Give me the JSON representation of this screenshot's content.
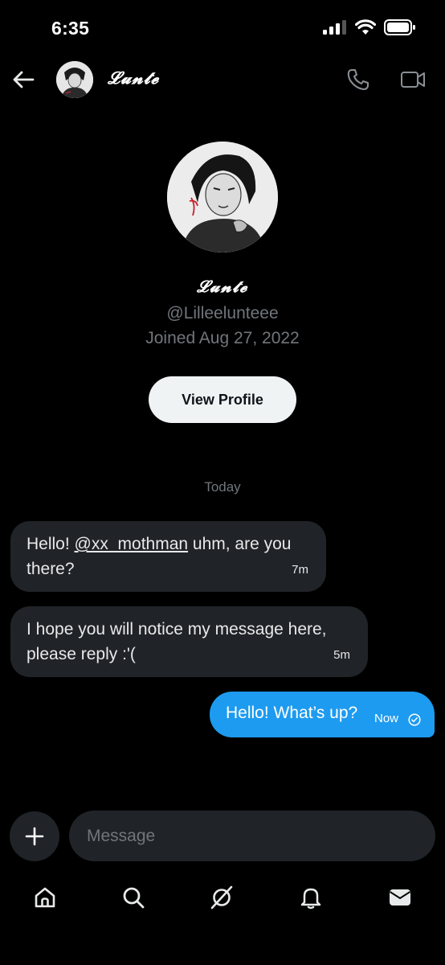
{
  "status_bar": {
    "time": "6:35"
  },
  "header": {
    "name": "𝓛𝓾𝓷𝓽𝓮",
    "back_icon": "arrow-left-icon",
    "call_icon": "phone-icon",
    "video_icon": "video-camera-icon"
  },
  "profile": {
    "display_name": "𝓛𝓾𝓷𝓽𝓮",
    "handle": "@Lilleelunteee",
    "joined": "Joined Aug 27, 2022",
    "view_profile_label": "View Profile"
  },
  "conversation": {
    "date_separator": "Today",
    "messages": [
      {
        "direction": "incoming",
        "text_before": "Hello! ",
        "mention": "@xx_mothman",
        "text_line1_after": " uhm, are you",
        "text_line2": "there?",
        "time": "7m"
      },
      {
        "direction": "incoming",
        "text_line1": "I hope you will notice my message here,",
        "text_line2": "please reply :'(",
        "time": "5m"
      },
      {
        "direction": "outgoing",
        "text": "Hello! What’s up?",
        "time": "Now",
        "status_icon": "check-circle-icon"
      }
    ]
  },
  "composer": {
    "placeholder": "Message",
    "add_icon": "plus-icon"
  },
  "bottom_nav": [
    {
      "icon": "home-icon"
    },
    {
      "icon": "search-icon"
    },
    {
      "icon": "grok-icon"
    },
    {
      "icon": "bell-icon"
    },
    {
      "icon": "mail-icon"
    }
  ],
  "colors": {
    "background": "#000000",
    "bubble_incoming": "#202327",
    "bubble_outgoing": "#1d9bf0",
    "muted_text": "#71767b",
    "button_light": "#eff3f4"
  }
}
